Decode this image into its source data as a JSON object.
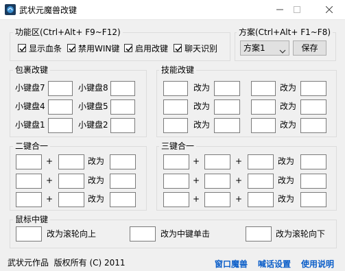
{
  "window": {
    "title": "武状元魔兽改键"
  },
  "func_area": {
    "label": "功能区(Ctrl+Alt+ F9~F12)",
    "checkboxes": [
      {
        "label": "显示血条",
        "checked": true
      },
      {
        "label": "禁用WIN键",
        "checked": true
      },
      {
        "label": "启用改键",
        "checked": true
      },
      {
        "label": "聊天识别",
        "checked": true
      }
    ]
  },
  "scheme": {
    "label": "方案(Ctrl+Alt+ F1~F8)",
    "selected": "方案1",
    "save_label": "保存"
  },
  "item_keys": {
    "label": "包裹改键",
    "keys": [
      "小键盘7",
      "小键盘8",
      "小键盘4",
      "小键盘5",
      "小键盘1",
      "小键盘2"
    ]
  },
  "skill_keys": {
    "label": "技能改键",
    "change_label": "改为"
  },
  "combo2": {
    "label": "二键合一",
    "plus": "+",
    "change_label": "改为"
  },
  "combo3": {
    "label": "三键合一",
    "plus": "+",
    "change_label": "改为"
  },
  "mouse_middle": {
    "label": "鼠标中键",
    "options": [
      "改为滚轮向上",
      "改为中键单击",
      "改为滚轮向下"
    ]
  },
  "footer": {
    "credit": "武状元作品  版权所有 (C) 2011",
    "links": [
      "窗口魔兽",
      "喊话设置",
      "使用说明"
    ]
  }
}
